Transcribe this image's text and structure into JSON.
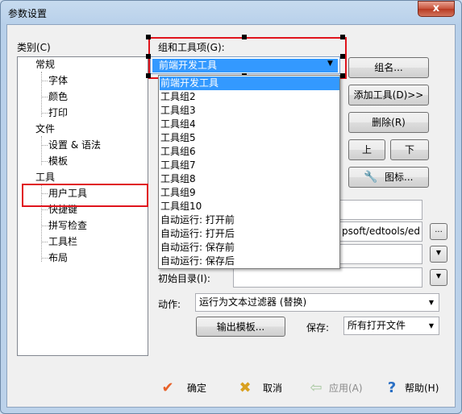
{
  "window": {
    "title": "参数设置",
    "close_glyph": "x"
  },
  "category": {
    "label": "类别(C)",
    "items": [
      {
        "label": "常规"
      },
      {
        "label": "字体"
      },
      {
        "label": "颜色"
      },
      {
        "label": "打印"
      },
      {
        "label": "文件"
      },
      {
        "label": "设置 & 语法"
      },
      {
        "label": "模板"
      },
      {
        "label": "工具"
      },
      {
        "label": "用户工具"
      },
      {
        "label": "快捷键"
      },
      {
        "label": "拼写检查"
      },
      {
        "label": "工具栏"
      },
      {
        "label": "布局"
      }
    ]
  },
  "group": {
    "label": "组和工具项(G):",
    "selected": "前端开发工具",
    "options": [
      "前端开发工具",
      "工具组2",
      "工具组3",
      "工具组4",
      "工具组5",
      "工具组6",
      "工具组7",
      "工具组8",
      "工具组9",
      "工具组10",
      "自动运行: 打开前",
      "自动运行: 打开后",
      "自动运行: 保存前",
      "自动运行: 保存后"
    ]
  },
  "buttons": {
    "group_name": "组名...",
    "add_tool": "添加工具(D)>>",
    "delete": "删除(R)",
    "up": "上",
    "down": "下",
    "icon": "图标...",
    "output_template": "输出模板...",
    "browse": "...",
    "ok": "确定",
    "cancel": "取消",
    "apply": "应用(A)",
    "help": "帮助(H)"
  },
  "fields": {
    "command_value": "psoft/edtools/ed",
    "initial_dir_label": "初始目录(I):",
    "action_label": "动作:",
    "action_value": "运行为文本过滤器 (替换)",
    "save_label": "保存:",
    "save_value": "所有打开文件"
  },
  "icons": {
    "ok": "check-icon",
    "cancel": "x-icon",
    "apply": "back-arrow-icon",
    "help": "question-icon",
    "tool": "wrench-icon"
  },
  "colors": {
    "highlight_frame": "#e0141c",
    "selection": "#3399ff"
  }
}
